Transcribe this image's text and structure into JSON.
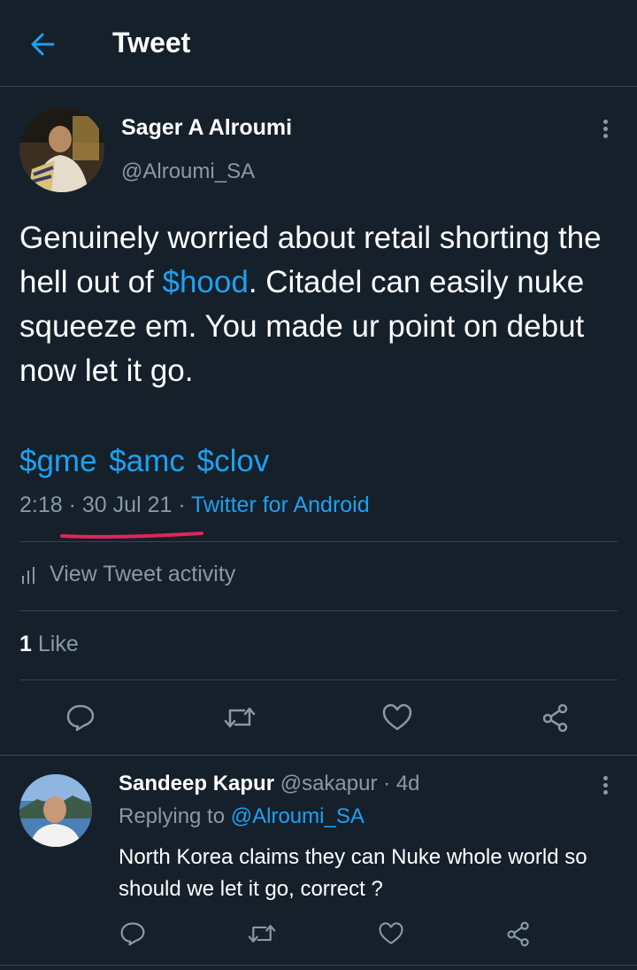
{
  "header": {
    "title": "Tweet"
  },
  "tweet": {
    "author_name": "Sager A Alroumi",
    "author_handle": "@Alroumi_SA",
    "text_before": "Genuinely worried about retail shorting the hell out of ",
    "text_link": "$hood",
    "text_after": ". Citadel can easily nuke squeeze em. You made ur point on debut now let it go.",
    "cashtags": [
      "$gme",
      "$amc",
      "$clov"
    ],
    "time": "2:18",
    "date": "30 Jul 21",
    "source": "Twitter for Android",
    "activity_label": "View Tweet activity",
    "like_count": "1",
    "like_label": "Like"
  },
  "reply": {
    "author_name": "Sandeep Kapur",
    "author_handle": "@sakapur",
    "age": "4d",
    "replying_prefix": "Replying to",
    "replying_handle": "@Alroumi_SA",
    "text": "North Korea claims they can Nuke whole world so should we let it go, correct ?"
  },
  "icons": {
    "back": "arrow-left-icon",
    "more": "more-vertical-icon",
    "activity": "bar-chart-icon",
    "reply": "comment-icon",
    "retweet": "retweet-icon",
    "like": "heart-icon",
    "share": "share-icon"
  },
  "colors": {
    "background": "#15202b",
    "accent": "#1da1f2",
    "muted": "#8899a6",
    "divider": "#38444d",
    "annotation": "#e0245e"
  }
}
